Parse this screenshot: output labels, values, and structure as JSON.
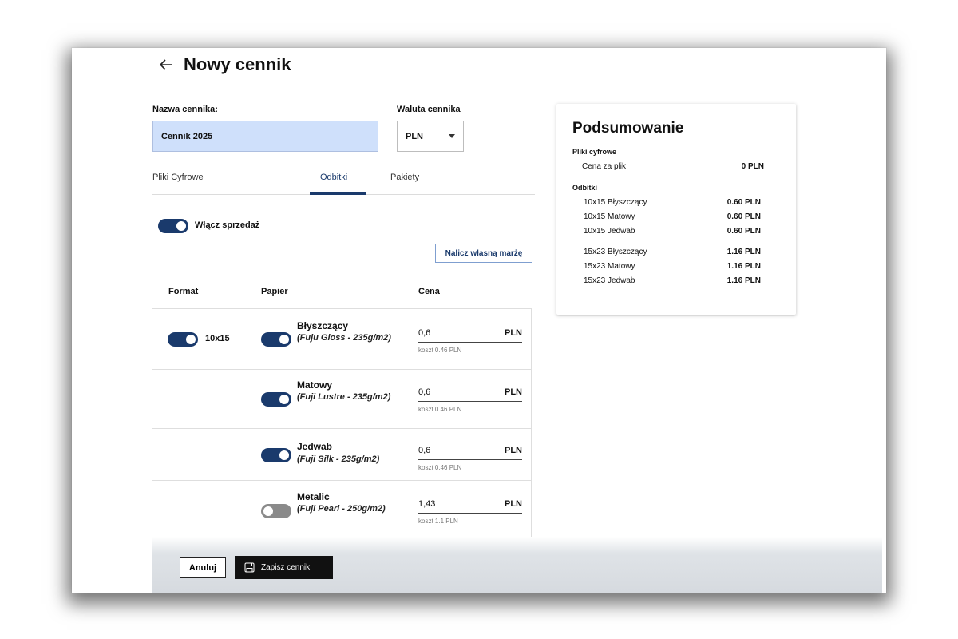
{
  "header": {
    "title": "Nowy cennik"
  },
  "form": {
    "name_label": "Nazwa cennika:",
    "name_value": "Cennik 2025",
    "currency_label": "Waluta cennika",
    "currency_value": "PLN"
  },
  "tabs": [
    {
      "label": "Pliki Cyfrowe",
      "active": false
    },
    {
      "label": "Odbitki",
      "active": true
    },
    {
      "label": "Pakiety",
      "active": false
    }
  ],
  "sales_toggle": {
    "label": "Włącz sprzedaż",
    "on": true
  },
  "margin_button": "Nalicz własną marżę",
  "columns": {
    "format": "Format",
    "paper": "Papier",
    "price": "Cena"
  },
  "rows": [
    {
      "format": "10x15",
      "format_on": true,
      "paper": "Błyszczący",
      "paper_desc": "(Fuju Gloss - 235g/m2)",
      "paper_on": true,
      "price": "0,6",
      "currency": "PLN",
      "cost": "koszt 0.46 PLN"
    },
    {
      "format": "",
      "paper": "Matowy",
      "paper_desc": "(Fuji Lustre - 235g/m2)",
      "paper_on": true,
      "price": "0,6",
      "currency": "PLN",
      "cost": "koszt 0.46 PLN"
    },
    {
      "format": "",
      "paper": "Jedwab",
      "paper_desc": "(Fuji Silk - 235g/m2)",
      "paper_on": true,
      "price": "0,6",
      "currency": "PLN",
      "cost": "koszt 0.46 PLN"
    },
    {
      "format": "",
      "paper": "Metalic",
      "paper_desc": "(Fuji Pearl - 250g/m2)",
      "paper_on": false,
      "price": "1,43",
      "currency": "PLN",
      "cost": "koszt 1.1 PLN"
    }
  ],
  "footer": {
    "cancel": "Anuluj",
    "save": "Zapisz cennik"
  },
  "summary": {
    "title": "Podsumowanie",
    "digital_heading": "Pliki cyfrowe",
    "digital_items": [
      {
        "label": "Cena za plik",
        "value": "0 PLN"
      }
    ],
    "prints_heading": "Odbitki",
    "prints_items": [
      {
        "label": "10x15 Błyszczący",
        "value": "0.60 PLN"
      },
      {
        "label": "10x15 Matowy",
        "value": "0.60 PLN"
      },
      {
        "label": "10x15 Jedwab",
        "value": "0.60 PLN"
      },
      {
        "label": "15x23 Błyszczący",
        "value": "1.16 PLN"
      },
      {
        "label": "15x23 Matowy",
        "value": "1.16 PLN"
      },
      {
        "label": "15x23 Jedwab",
        "value": "1.16 PLN"
      }
    ]
  },
  "colors": {
    "accent": "#1a3a6c",
    "input_bg": "#cfe0fb",
    "toggle_off": "#8a8a8a"
  }
}
